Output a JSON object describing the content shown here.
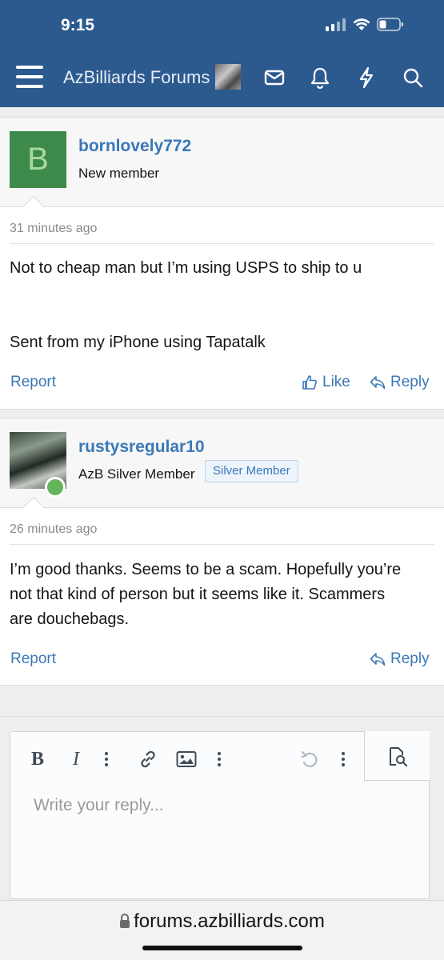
{
  "status": {
    "time": "9:15"
  },
  "header": {
    "title": "AzBilliards Forums"
  },
  "posts": [
    {
      "avatar_letter": "B",
      "username": "bornlovely772",
      "user_title": "New member",
      "date": "31 minutes ago",
      "body_line1": "Not to cheap man but I’m using USPS to ship to u",
      "body_line2": "Sent from my iPhone using Tapatalk",
      "report": "Report",
      "like": "Like",
      "reply": "Reply"
    },
    {
      "username": "rustysregular10",
      "user_title": "AzB Silver Member",
      "badge": "Silver Member",
      "date": "26 minutes ago",
      "body": "I’m good thanks. Seems to be a scam. Hopefully you’re not that kind of person but it seems like it. Scammers are douchebags.",
      "report": "Report",
      "reply": "Reply"
    }
  ],
  "editor": {
    "placeholder": "Write your reply..."
  },
  "browser": {
    "url": "forums.azbilliards.com"
  },
  "colors": {
    "header_bg": "#2c5a8f",
    "link": "#3a78b8",
    "avatar_green": "#3d8a4a",
    "online": "#63b45a"
  }
}
